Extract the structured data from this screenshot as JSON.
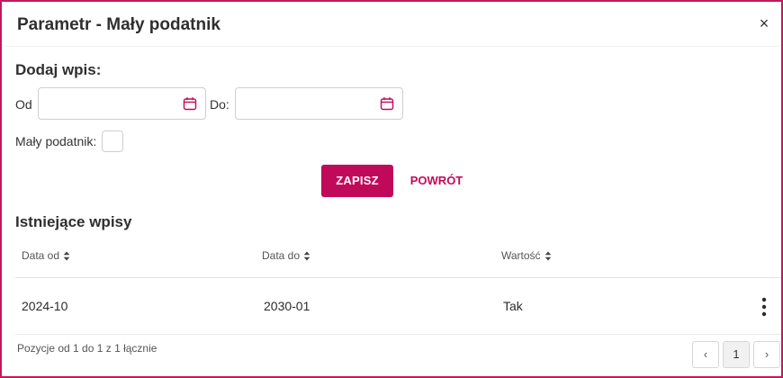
{
  "dialog": {
    "title": "Parametr - Mały podatnik",
    "close_glyph": "×"
  },
  "form": {
    "heading": "Dodaj wpis:",
    "from_label": "Od",
    "from_value": "",
    "to_label": "Do:",
    "to_value": "",
    "small_taxpayer_label": "Mały podatnik:",
    "small_taxpayer_checked": false,
    "save_label": "ZAPISZ",
    "back_label": "POWRÓT"
  },
  "existing": {
    "heading": "Istniejące wpisy",
    "columns": [
      "Data od",
      "Data do",
      "Wartość"
    ],
    "rows": [
      {
        "date_from": "2024-10",
        "date_to": "2030-01",
        "value": "Tak"
      }
    ]
  },
  "pagination": {
    "info": "Pozycje od 1 do 1 z 1 łącznie",
    "prev_glyph": "‹",
    "current_page": "1",
    "next_glyph": "›"
  },
  "colors": {
    "accent": "#c1095a",
    "frame": "#c2185b"
  },
  "icons": {
    "close": "close-icon",
    "calendar": "calendar-icon",
    "sort": "sort-icon",
    "row_menu": "more-vertical-icon"
  }
}
